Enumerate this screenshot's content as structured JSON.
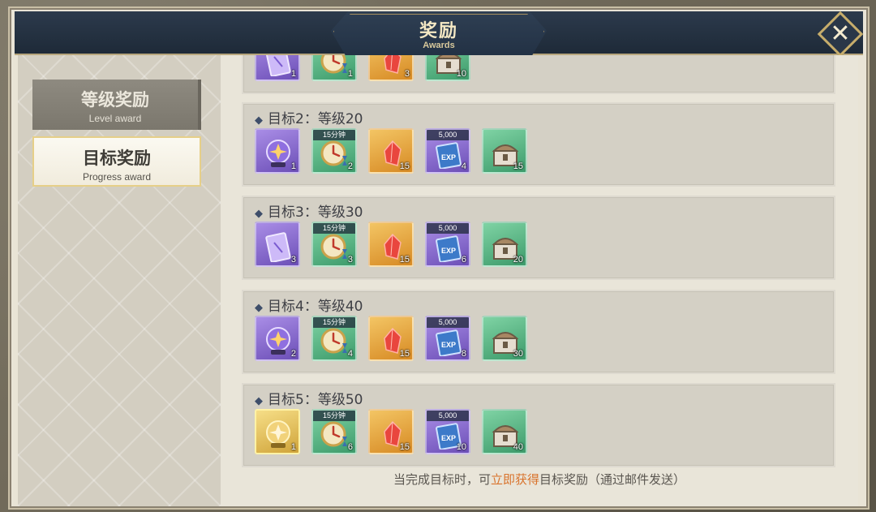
{
  "header": {
    "title": "奖励",
    "subtitle": "Awards"
  },
  "sidebar": {
    "tabs": [
      {
        "cn": "等级奖励",
        "en": "Level award"
      },
      {
        "cn": "目标奖励",
        "en": "Progress award"
      }
    ]
  },
  "goals": [
    {
      "title": "",
      "items": [
        {
          "icon": "card-icon",
          "count": "1"
        },
        {
          "icon": "clock-icon",
          "count": "1"
        },
        {
          "icon": "crystal-icon",
          "count": "3"
        },
        {
          "icon": "chest-icon",
          "count": "10"
        }
      ]
    },
    {
      "title": "目标2：等级20",
      "items": [
        {
          "icon": "orb-icon",
          "count": "1"
        },
        {
          "icon": "clock-icon",
          "tag": "15分钟",
          "count": "2"
        },
        {
          "icon": "crystal-icon",
          "count": "15"
        },
        {
          "icon": "exp-book-icon",
          "tag": "5,000",
          "count": "4"
        },
        {
          "icon": "chest-icon",
          "count": "15"
        }
      ]
    },
    {
      "title": "目标3：等级30",
      "items": [
        {
          "icon": "card-icon",
          "count": "3"
        },
        {
          "icon": "clock-icon",
          "tag": "15分钟",
          "count": "3"
        },
        {
          "icon": "crystal-icon",
          "count": "15"
        },
        {
          "icon": "exp-book-icon",
          "tag": "5,000",
          "count": "6"
        },
        {
          "icon": "chest-icon",
          "count": "20"
        }
      ]
    },
    {
      "title": "目标4：等级40",
      "items": [
        {
          "icon": "orb-icon",
          "count": "2"
        },
        {
          "icon": "clock-icon",
          "tag": "15分钟",
          "count": "4"
        },
        {
          "icon": "crystal-icon",
          "count": "15"
        },
        {
          "icon": "exp-book-icon",
          "tag": "5,000",
          "count": "8"
        },
        {
          "icon": "chest-icon",
          "count": "30"
        }
      ]
    },
    {
      "title": "目标5：等级50",
      "items": [
        {
          "icon": "gold-orb-icon",
          "count": "1"
        },
        {
          "icon": "clock-icon",
          "tag": "15分钟",
          "count": "6"
        },
        {
          "icon": "crystal-icon",
          "count": "15"
        },
        {
          "icon": "exp-book-icon",
          "tag": "5,000",
          "count": "10"
        },
        {
          "icon": "chest-icon",
          "count": "40"
        }
      ]
    }
  ],
  "footer": {
    "prefix": "当完成目标时，可",
    "highlight": "立即获得",
    "suffix": "目标奖励（通过邮件发送）"
  },
  "colors": {
    "accent": "#d9732c",
    "header": "#1e2a38",
    "frame_gold": "#c7ad6b"
  }
}
